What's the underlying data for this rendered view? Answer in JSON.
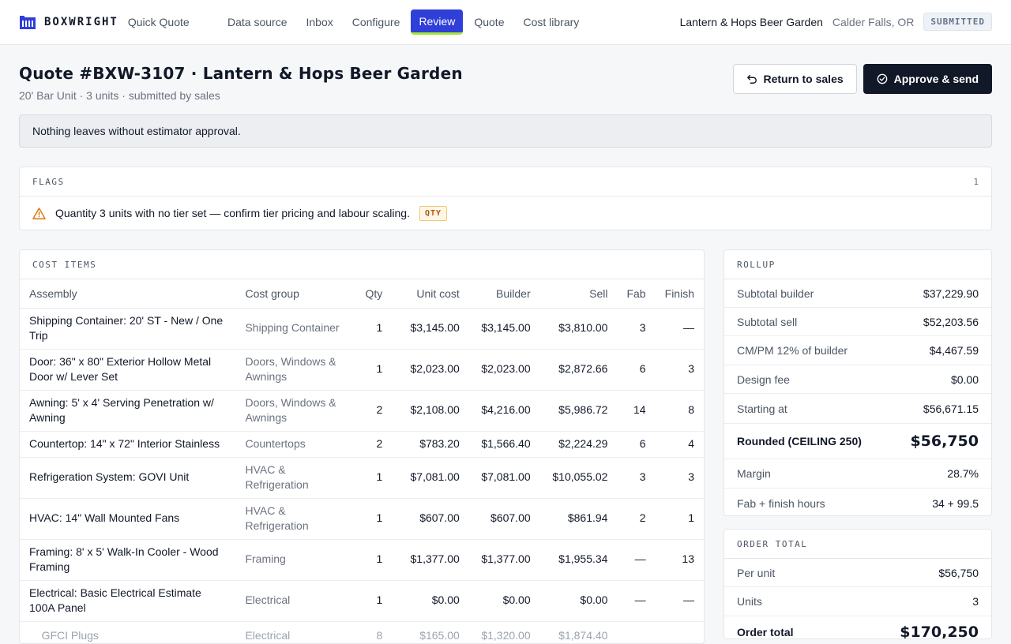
{
  "brand": {
    "name": "BOXWRIGHT",
    "product": "Quick Quote"
  },
  "nav": [
    {
      "label": "Data source",
      "active": false
    },
    {
      "label": "Inbox",
      "active": false
    },
    {
      "label": "Configure",
      "active": false
    },
    {
      "label": "Review",
      "active": true
    },
    {
      "label": "Quote",
      "active": false
    },
    {
      "label": "Cost library",
      "active": false
    }
  ],
  "topbar": {
    "customer": "Lantern & Hops Beer Garden",
    "location": "Calder Falls, OR",
    "status": "SUBMITTED"
  },
  "header": {
    "title": "Quote #BXW-3107 · Lantern & Hops Beer Garden",
    "subtitle": "20' Bar Unit · 3 units · submitted by sales",
    "return_label": "Return to sales",
    "approve_label": "Approve & send"
  },
  "notice": "Nothing leaves without estimator approval.",
  "flags": {
    "label": "FLAGS",
    "count": "1",
    "items": [
      {
        "text": "Quantity 3 units with no tier set — confirm tier pricing and labour scaling.",
        "tag": "QTY"
      }
    ]
  },
  "cost_items": {
    "label": "COST ITEMS",
    "columns": [
      "Assembly",
      "Cost group",
      "Qty",
      "Unit cost",
      "Builder",
      "Sell",
      "Fab",
      "Finish"
    ],
    "rows": [
      {
        "assembly": "Shipping Container: 20' ST - New / One Trip",
        "group": "Shipping Container",
        "qty": "1",
        "unit": "$3,145.00",
        "builder": "$3,145.00",
        "sell": "$3,810.00",
        "fab": "3",
        "finish": "—"
      },
      {
        "assembly": "Door: 36\" x 80\" Exterior Hollow Metal Door w/ Lever Set",
        "group": "Doors, Windows & Awnings",
        "qty": "1",
        "unit": "$2,023.00",
        "builder": "$2,023.00",
        "sell": "$2,872.66",
        "fab": "6",
        "finish": "3"
      },
      {
        "assembly": "Awning: 5' x 4' Serving Penetration w/ Awning",
        "group": "Doors, Windows & Awnings",
        "qty": "2",
        "unit": "$2,108.00",
        "builder": "$4,216.00",
        "sell": "$5,986.72",
        "fab": "14",
        "finish": "8"
      },
      {
        "assembly": "Countertop: 14\" x 72\" Interior Stainless",
        "group": "Countertops",
        "qty": "2",
        "unit": "$783.20",
        "builder": "$1,566.40",
        "sell": "$2,224.29",
        "fab": "6",
        "finish": "4"
      },
      {
        "assembly": "Refrigeration System: GOVI Unit",
        "group": "HVAC & Refrigeration",
        "qty": "1",
        "unit": "$7,081.00",
        "builder": "$7,081.00",
        "sell": "$10,055.02",
        "fab": "3",
        "finish": "3"
      },
      {
        "assembly": "HVAC: 14\" Wall Mounted Fans",
        "group": "HVAC & Refrigeration",
        "qty": "1",
        "unit": "$607.00",
        "builder": "$607.00",
        "sell": "$861.94",
        "fab": "2",
        "finish": "1"
      },
      {
        "assembly": "Framing: 8' x 5' Walk-In Cooler - Wood Framing",
        "group": "Framing",
        "qty": "1",
        "unit": "$1,377.00",
        "builder": "$1,377.00",
        "sell": "$1,955.34",
        "fab": "—",
        "finish": "13"
      },
      {
        "assembly": "Electrical: Basic Electrical Estimate 100A Panel",
        "group": "Electrical",
        "qty": "1",
        "unit": "$0.00",
        "builder": "$0.00",
        "sell": "$0.00",
        "fab": "—",
        "finish": "—"
      },
      {
        "assembly": "GFCI Plugs",
        "group": "Electrical",
        "qty": "8",
        "unit": "$165.00",
        "builder": "$1,320.00",
        "sell": "$1,874.40",
        "fab": "",
        "finish": ""
      }
    ]
  },
  "rollup": {
    "label": "ROLLUP",
    "rows": [
      {
        "k": "Subtotal builder",
        "v": "$37,229.90"
      },
      {
        "k": "Subtotal sell",
        "v": "$52,203.56"
      },
      {
        "k": "CM/PM 12% of builder",
        "v": "$4,467.59"
      },
      {
        "k": "Design fee",
        "v": "$0.00"
      },
      {
        "k": "Starting at",
        "v": "$56,671.15"
      },
      {
        "k": "Rounded (CEILING 250)",
        "v": "$56,750"
      },
      {
        "k": "Margin",
        "v": "28.7%"
      },
      {
        "k": "Fab + finish hours",
        "v": "34 + 99.5"
      }
    ]
  },
  "order_total": {
    "label": "ORDER TOTAL",
    "rows": [
      {
        "k": "Per unit",
        "v": "$56,750"
      },
      {
        "k": "Units",
        "v": "3"
      },
      {
        "k": "Order total",
        "v": "$170,250"
      }
    ]
  }
}
